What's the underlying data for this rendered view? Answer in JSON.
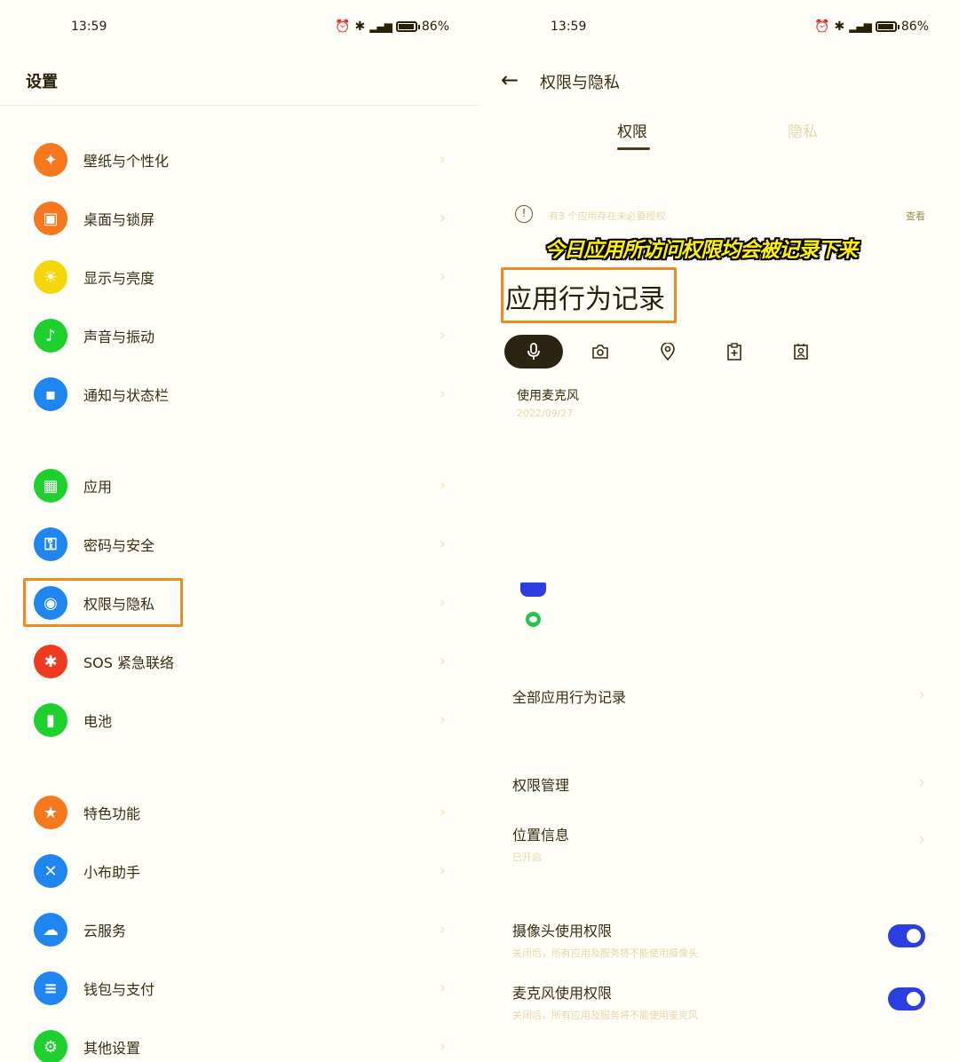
{
  "left": {
    "status": {
      "time": "13:59",
      "battery": "86%"
    },
    "title": "设置",
    "items": [
      {
        "label": "壁纸与个性化",
        "icon": "palette-icon",
        "color": "#f5781f"
      },
      {
        "label": "桌面与锁屏",
        "icon": "image-icon",
        "color": "#f5781f"
      },
      {
        "label": "显示与亮度",
        "icon": "sun-icon",
        "color": "#f5d60a"
      },
      {
        "label": "声音与振动",
        "icon": "bell-icon",
        "color": "#1fcf2d"
      },
      {
        "label": "通知与状态栏",
        "icon": "notification-icon",
        "color": "#1f86f0"
      },
      {
        "label": "应用",
        "icon": "apps-grid-icon",
        "color": "#1fcf2d"
      },
      {
        "label": "密码与安全",
        "icon": "key-icon",
        "color": "#1f86f0"
      },
      {
        "label": "权限与隐私",
        "icon": "privacy-eye-icon",
        "color": "#1f86f0"
      },
      {
        "label": "SOS 紧急联络",
        "icon": "sos-asterisk-icon",
        "color": "#f03a1f"
      },
      {
        "label": "电池",
        "icon": "battery-icon",
        "color": "#1fcf2d"
      },
      {
        "label": "特色功能",
        "icon": "star-icon",
        "color": "#f5781f"
      },
      {
        "label": "小布助手",
        "icon": "assistant-icon",
        "color": "#1f86f0"
      },
      {
        "label": "云服务",
        "icon": "cloud-icon",
        "color": "#1f86f0"
      },
      {
        "label": "钱包与支付",
        "icon": "wallet-icon",
        "color": "#1f86f0"
      },
      {
        "label": "其他设置",
        "icon": "gear-icon",
        "color": "#1fcf2d"
      }
    ]
  },
  "right": {
    "status": {
      "time": "13:59",
      "battery": "86%"
    },
    "title": "权限与隐私",
    "tabs": [
      "权限",
      "隐私"
    ],
    "notice": {
      "text": "有3 个应用存在未必要授权",
      "link": "查看"
    },
    "caption": "今日应用所访问权限均会被记录下来",
    "section_heading": "应用行为记录",
    "perm_icons": [
      "microphone-icon",
      "camera-icon",
      "location-icon",
      "clipboard-icon",
      "contacts-icon"
    ],
    "usage": {
      "title": "使用麦克风",
      "date": "2022/09/27"
    },
    "rows": {
      "all_records": "全部应用行为记录",
      "perm_manage": "权限管理",
      "location": {
        "title": "位置信息",
        "sub": "已开启"
      },
      "camera": {
        "title": "摄像头使用权限",
        "sub": "关闭后，所有应用及服务将不能使用摄像头",
        "on": true
      },
      "mic": {
        "title": "麦克风使用权限",
        "sub": "关闭后，所有应用及服务将不能使用麦克风",
        "on": true
      }
    },
    "accent_color": "#2b3fe0",
    "highlight_color": "#f28a1f"
  }
}
